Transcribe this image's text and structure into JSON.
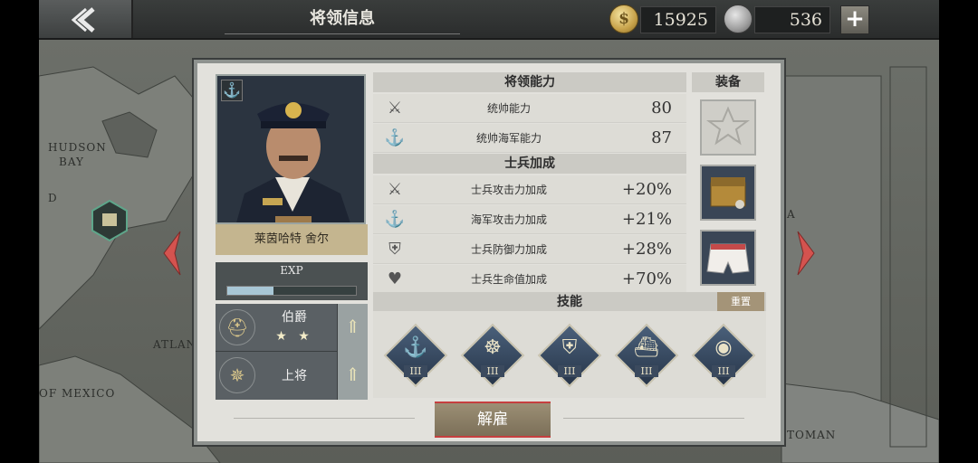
{
  "topbar": {
    "title": "将领信息",
    "gold": "15925",
    "medals": "536",
    "gold_icon": "$"
  },
  "map": {
    "labels": [
      "HUDSON",
      "BAY",
      "ATLAN",
      "OF MEXICO",
      "A",
      "TOMAN",
      "D"
    ]
  },
  "general": {
    "name": "莱茵哈特 舍尔",
    "exp_label": "EXP",
    "exp_progress": 0.36,
    "rank_title": "伯爵",
    "rank_stars": "★ ★",
    "military_rank": "上将"
  },
  "abilities": {
    "header": "将领能力",
    "rows": [
      {
        "label": "统帅能力",
        "value": "80"
      },
      {
        "label": "统帅海军能力",
        "value": "87"
      }
    ]
  },
  "bonuses": {
    "header": "士兵加成",
    "rows": [
      {
        "label": "士兵攻击力加成",
        "value": "+20%"
      },
      {
        "label": "海军攻击力加成",
        "value": "+21%"
      },
      {
        "label": "士兵防御力加成",
        "value": "+28%"
      },
      {
        "label": "士兵生命值加成",
        "value": "+70%"
      }
    ]
  },
  "equipment": {
    "header": "装备"
  },
  "skills": {
    "header": "技能",
    "reset_label": "重置",
    "items": [
      {
        "icon": "anchor-icon",
        "level": "III"
      },
      {
        "icon": "ship-wheel-icon",
        "level": "III"
      },
      {
        "icon": "warship-shield-icon",
        "level": "III"
      },
      {
        "icon": "battleship-icon",
        "level": "III"
      },
      {
        "icon": "eye-icon",
        "level": "III"
      }
    ]
  },
  "actions": {
    "dismiss_label": "解雇"
  },
  "colors": {
    "accent_red": "#c63f3f",
    "panel_bg": "#e2e1dc",
    "name_plate": "#c4b58f"
  }
}
